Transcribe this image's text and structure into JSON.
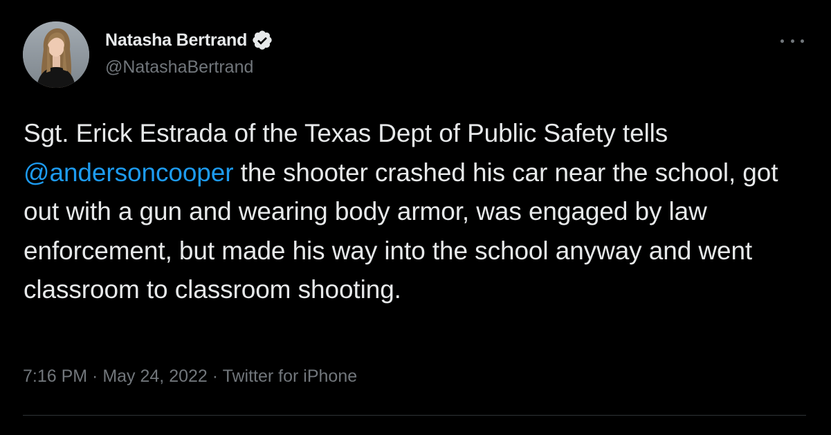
{
  "user": {
    "display_name": "Natasha Bertrand",
    "handle": "@NatashaBertrand"
  },
  "tweet": {
    "text_before_mention": "Sgt. Erick Estrada of the Texas Dept of Public Safety tells ",
    "mention": "@andersoncooper",
    "text_after_mention": " the shooter crashed his car near the school, got out with a gun and wearing body armor, was engaged by law enforcement, but made his way into the school anyway and went classroom to classroom shooting."
  },
  "meta": {
    "time": "7:16 PM",
    "separator": " · ",
    "date": "May 24, 2022",
    "source": "Twitter for iPhone"
  },
  "icons": {
    "verified": "verified-badge-icon",
    "more": "more-options-icon"
  },
  "colors": {
    "background": "#000000",
    "text": "#e7e9ea",
    "secondary": "#71767b",
    "link": "#1d9bf0",
    "divider": "#2f3336"
  }
}
